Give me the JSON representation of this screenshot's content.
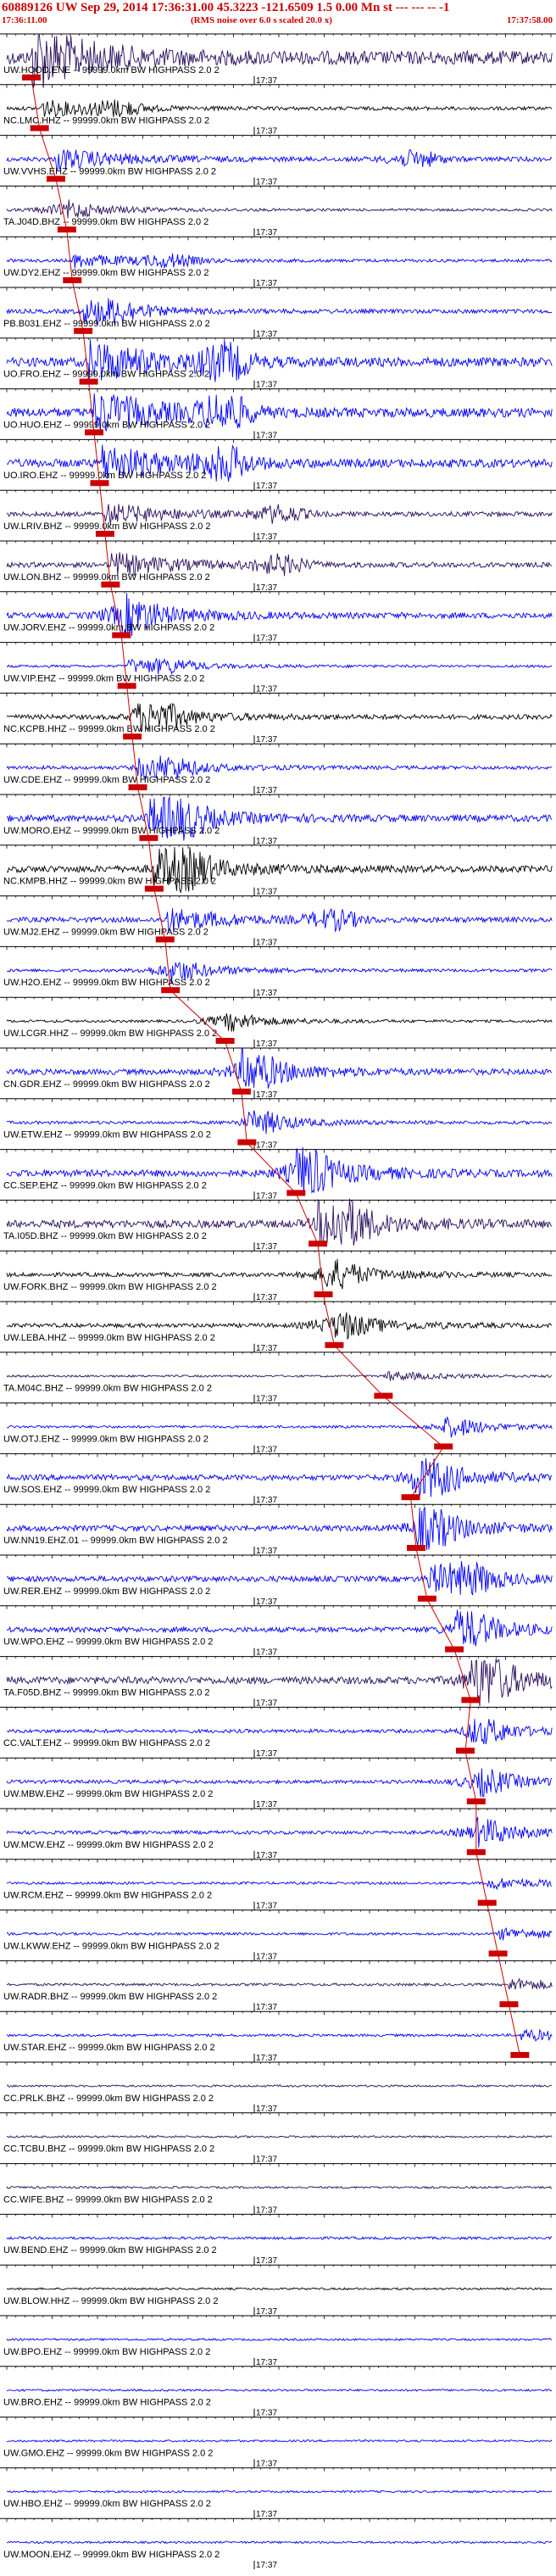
{
  "header": {
    "title": "60889126 UW Sep 29, 2014 17:36:31.00    45.3223 -121.6509   1.5 0.00 Mn st --- --- -- -1",
    "start_time": "17:36:11.00",
    "note": "(RMS noise over 6.0 s scaled 20.0 x)",
    "end_time": "17:37:58.00"
  },
  "minute_marker_label": "17:37",
  "colors": {
    "title": "#cc0000",
    "pick": "#cc0000",
    "trace_black": "#000000",
    "trace_navy": "#2a0f5e",
    "trace_blue": "#0000ff"
  },
  "channel_suffix": "-- 99999.0km BW  HIGHPASS  2.0  2",
  "traces": [
    {
      "station": "UW.HOOD.ENE",
      "color": "trace_navy",
      "pick": 0.045,
      "amp": 2.6,
      "burst": 0.0
    },
    {
      "station": "NC.LMC.HHZ",
      "color": "trace_black",
      "pick": 0.06,
      "amp": 0.7,
      "burst": 0.2
    },
    {
      "station": "UW.VVHS.EHZ",
      "color": "trace_blue",
      "pick": 0.09,
      "amp": 0.9,
      "burst": 0.75
    },
    {
      "station": "TA.J04D.BHZ",
      "color": "trace_navy",
      "pick": 0.11,
      "amp": 0.5,
      "burst": 0.1
    },
    {
      "station": "UW.DY2.EHZ",
      "color": "trace_blue",
      "pick": 0.12,
      "amp": 0.6,
      "burst": 0.3
    },
    {
      "station": "PB.B031.EHZ",
      "color": "trace_blue",
      "pick": 0.14,
      "amp": 0.8,
      "burst": 0.2
    },
    {
      "station": "UO.FRO.EHZ",
      "color": "trace_blue",
      "pick": 0.15,
      "amp": 1.8,
      "burst": 0.4
    },
    {
      "station": "UO.HUO.EHZ",
      "color": "trace_blue",
      "pick": 0.16,
      "amp": 1.8,
      "burst": 0.4
    },
    {
      "station": "UO.IRO.EHZ",
      "color": "trace_blue",
      "pick": 0.17,
      "amp": 1.6,
      "burst": 0.4
    },
    {
      "station": "UW.LRIV.BHZ",
      "color": "trace_navy",
      "pick": 0.18,
      "amp": 0.9,
      "burst": 0.5
    },
    {
      "station": "UW.LON.BHZ",
      "color": "trace_navy",
      "pick": 0.19,
      "amp": 1.0,
      "burst": 0.5
    },
    {
      "station": "UW.JORV.EHZ",
      "color": "trace_blue",
      "pick": 0.21,
      "amp": 1.1,
      "burst": 0.22
    },
    {
      "station": "UW.VIP.EHZ",
      "color": "trace_blue",
      "pick": 0.22,
      "amp": 0.5,
      "burst": 0.3
    },
    {
      "station": "NC.KCPB.HHZ",
      "color": "trace_black",
      "pick": 0.23,
      "amp": 0.9,
      "burst": 0.28
    },
    {
      "station": "UW.CDE.EHZ",
      "color": "trace_blue",
      "pick": 0.24,
      "amp": 0.7,
      "burst": 0.3
    },
    {
      "station": "UW.MORO.EHZ",
      "color": "trace_blue",
      "pick": 0.26,
      "amp": 1.3,
      "burst": 0.32
    },
    {
      "station": "NC.KMPB.HHZ",
      "color": "trace_black",
      "pick": 0.27,
      "amp": 1.3,
      "burst": 0.33
    },
    {
      "station": "UW.MJ2.EHZ",
      "color": "trace_blue",
      "pick": 0.29,
      "amp": 1.0,
      "burst": 0.6
    },
    {
      "station": "UW.H2O.EHZ",
      "color": "trace_blue",
      "pick": 0.3,
      "amp": 0.6,
      "burst": 0.3
    },
    {
      "station": "UW.LCGR.HHZ",
      "color": "trace_black",
      "pick": 0.4,
      "amp": 0.5,
      "burst": 0.4
    },
    {
      "station": "CN.GDR.EHZ",
      "color": "trace_blue",
      "pick": 0.43,
      "amp": 1.1,
      "burst": 0.45
    },
    {
      "station": "UW.ETW.EHZ",
      "color": "trace_blue",
      "pick": 0.44,
      "amp": 0.6,
      "burst": 0.47
    },
    {
      "station": "CC.SEP.EHZ",
      "color": "trace_blue",
      "pick": 0.53,
      "amp": 1.3,
      "burst": 0.55
    },
    {
      "station": "TA.I05D.BHZ",
      "color": "trace_navy",
      "pick": 0.57,
      "amp": 1.5,
      "burst": 0.62
    },
    {
      "station": "UW.FORK.BHZ",
      "color": "trace_black",
      "pick": 0.58,
      "amp": 0.8,
      "burst": 0.6
    },
    {
      "station": "UW.LEBA.HHZ",
      "color": "trace_black",
      "pick": 0.6,
      "amp": 0.8,
      "burst": 0.6
    },
    {
      "station": "TA.M04C.BHZ",
      "color": "trace_navy",
      "pick": 0.69,
      "amp": 0.4,
      "burst": 0.0
    },
    {
      "station": "UW.OTJ.EHZ",
      "color": "trace_blue",
      "pick": 0.8,
      "amp": 0.5,
      "burst": 0.82
    },
    {
      "station": "UW.SOS.EHZ",
      "color": "trace_blue",
      "pick": 0.74,
      "amp": 1.1,
      "burst": 0.78
    },
    {
      "station": "UW.NN19.EHZ.01",
      "color": "trace_blue",
      "pick": 0.75,
      "amp": 1.1,
      "burst": 0.78
    },
    {
      "station": "UW.RER.EHZ",
      "color": "trace_blue",
      "pick": 0.77,
      "amp": 1.1,
      "burst": 0.85
    },
    {
      "station": "UW.WPO.EHZ",
      "color": "trace_blue",
      "pick": 0.82,
      "amp": 1.0,
      "burst": 0.85
    },
    {
      "station": "TA.F05D.BHZ",
      "color": "trace_navy",
      "pick": 0.85,
      "amp": 1.4,
      "burst": 0.88
    },
    {
      "station": "CC.VALT.EHZ",
      "color": "trace_blue",
      "pick": 0.84,
      "amp": 0.7,
      "burst": 0.88
    },
    {
      "station": "UW.MBW.EHZ",
      "color": "trace_blue",
      "pick": 0.86,
      "amp": 0.7,
      "burst": 0.87
    },
    {
      "station": "UW.MCW.EHZ",
      "color": "trace_blue",
      "pick": 0.86,
      "amp": 0.7,
      "burst": 0.87
    },
    {
      "station": "UW.RCM.EHZ",
      "color": "trace_blue",
      "pick": 0.88,
      "amp": 0.5,
      "burst": 0.0
    },
    {
      "station": "UW.LKWW.EHZ",
      "color": "trace_blue",
      "pick": 0.9,
      "amp": 0.5,
      "burst": 0.0
    },
    {
      "station": "UW.RADR.BHZ",
      "color": "trace_navy",
      "pick": 0.92,
      "amp": 0.5,
      "burst": 0.0
    },
    {
      "station": "UW.STAR.EHZ",
      "color": "trace_blue",
      "pick": 0.94,
      "amp": 0.5,
      "burst": 0.0
    },
    {
      "station": "CC.PRLK.BHZ",
      "color": "trace_navy",
      "pick": -1,
      "amp": 0.4,
      "burst": 0.0
    },
    {
      "station": "CC.TCBU.BHZ",
      "color": "trace_navy",
      "pick": -1,
      "amp": 0.4,
      "burst": 0.0
    },
    {
      "station": "CC.WIFE.BHZ",
      "color": "trace_navy",
      "pick": -1,
      "amp": 0.4,
      "burst": 0.0
    },
    {
      "station": "UW.BEND.EHZ",
      "color": "trace_blue",
      "pick": -1,
      "amp": 0.5,
      "burst": 0.0
    },
    {
      "station": "UW.BLOW.HHZ",
      "color": "trace_black",
      "pick": -1,
      "amp": 0.4,
      "burst": 0.0
    },
    {
      "station": "UW.BPO.EHZ",
      "color": "trace_blue",
      "pick": -1,
      "amp": 0.4,
      "burst": 0.0
    },
    {
      "station": "UW.BRO.EHZ",
      "color": "trace_blue",
      "pick": -1,
      "amp": 0.4,
      "burst": 0.0
    },
    {
      "station": "UW.GMO.EHZ",
      "color": "trace_blue",
      "pick": -1,
      "amp": 0.4,
      "burst": 0.0
    },
    {
      "station": "UW.HBO.EHZ",
      "color": "trace_blue",
      "pick": -1,
      "amp": 0.4,
      "burst": 0.0
    },
    {
      "station": "UW.MOON.EHZ",
      "color": "trace_blue",
      "pick": -1,
      "amp": 0.4,
      "burst": 0.0
    }
  ]
}
